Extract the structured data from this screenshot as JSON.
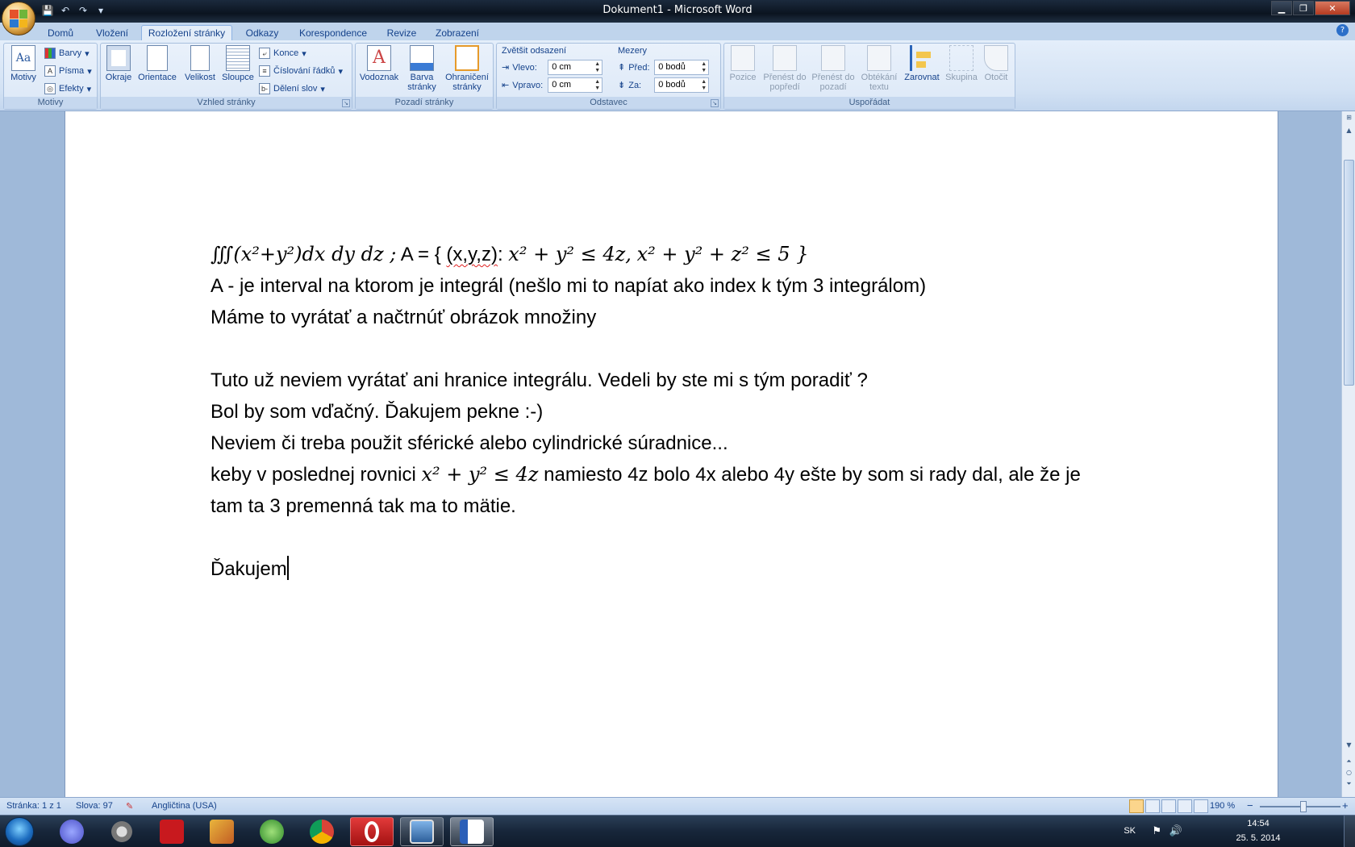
{
  "window": {
    "title": "Dokument1 - Microsoft Word",
    "min": "▁",
    "max": "❐",
    "close": "✕"
  },
  "qat": [
    "💾",
    "↶",
    "↷",
    "▾"
  ],
  "tabs": [
    "Domů",
    "Vložení",
    "Rozložení stránky",
    "Odkazy",
    "Korespondence",
    "Revize",
    "Zobrazení"
  ],
  "active_tab": "Rozložení stránky",
  "help": "?",
  "ribbon": {
    "motivy": {
      "label": "Motivy",
      "big": "Motivy",
      "small": [
        "Barvy",
        "Písma",
        "Efekty"
      ]
    },
    "vzhled": {
      "label": "Vzhled stránky",
      "buttons": [
        "Okraje",
        "Orientace",
        "Velikost",
        "Sloupce"
      ],
      "small": [
        "Konce",
        "Číslování řádků",
        "Dělení slov"
      ]
    },
    "pozadi": {
      "label": "Pozadí stránky",
      "buttons": [
        "Vodoznak",
        "Barva stránky",
        "Ohraničení stránky"
      ]
    },
    "odstavec": {
      "label": "Odstavec",
      "indent_title": "Zvětšit odsazení",
      "spacing_title": "Mezery",
      "vlevo_label": "Vlevo:",
      "vlevo_value": "0 cm",
      "vpravo_label": "Vpravo:",
      "vpravo_value": "0 cm",
      "pred_label": "Před:",
      "pred_value": "0 bodů",
      "za_label": "Za:",
      "za_value": "0 bodů"
    },
    "usporadat": {
      "label": "Uspořádat",
      "buttons": [
        "Pozice",
        "Přenést do popředí",
        "Přenést do pozadí",
        "Obtékání textu",
        "Zarovnat",
        "Skupina",
        "Otočit"
      ]
    }
  },
  "document": {
    "line1_integral": "∭(x²+y²)dx dy dz ;",
    "line1_set_prefix": "A = { ",
    "line1_set_vars": "(x,y,z)",
    "line1_set_colon": ": ",
    "line1_cond1": "x² + y² ≤ 4z,",
    "line1_cond2": "x² + y² +  z² ≤ 5 }",
    "lines": [
      "A - je interval na ktorom je integrál (nešlo mi to napíat ako index k tým 3 integrálom)",
      "Máme to vyrátať a načtrnúť obrázok množiny",
      "",
      "Tuto už neviem vyrátať ani hranice integrálu. Vedeli by ste mi s tým poradiť ?",
      "Bol by som vďačný. Ďakujem pekne :-)",
      "Neviem či treba použit sférické alebo cylindrické súradnice..."
    ],
    "line8_prefix": "keby v poslednej rovnici ",
    "line8_math": "x² + y² ≤ 4z",
    "line8_suffix": "  namiesto 4z bolo 4x alebo 4y ešte by som si rady dal, ale že je",
    "line9": "tam ta 3 premenná tak ma to mätie.",
    "last": "Ďakujem"
  },
  "status": {
    "page": "Stránka: 1 z 1",
    "words": "Slova: 97",
    "language": "Angličtina (USA)",
    "zoom": "190 %",
    "zoom_minus": "−",
    "zoom_plus": "+"
  },
  "tray": {
    "lang": "SK",
    "time": "14:54",
    "date": "25. 5. 2014"
  }
}
